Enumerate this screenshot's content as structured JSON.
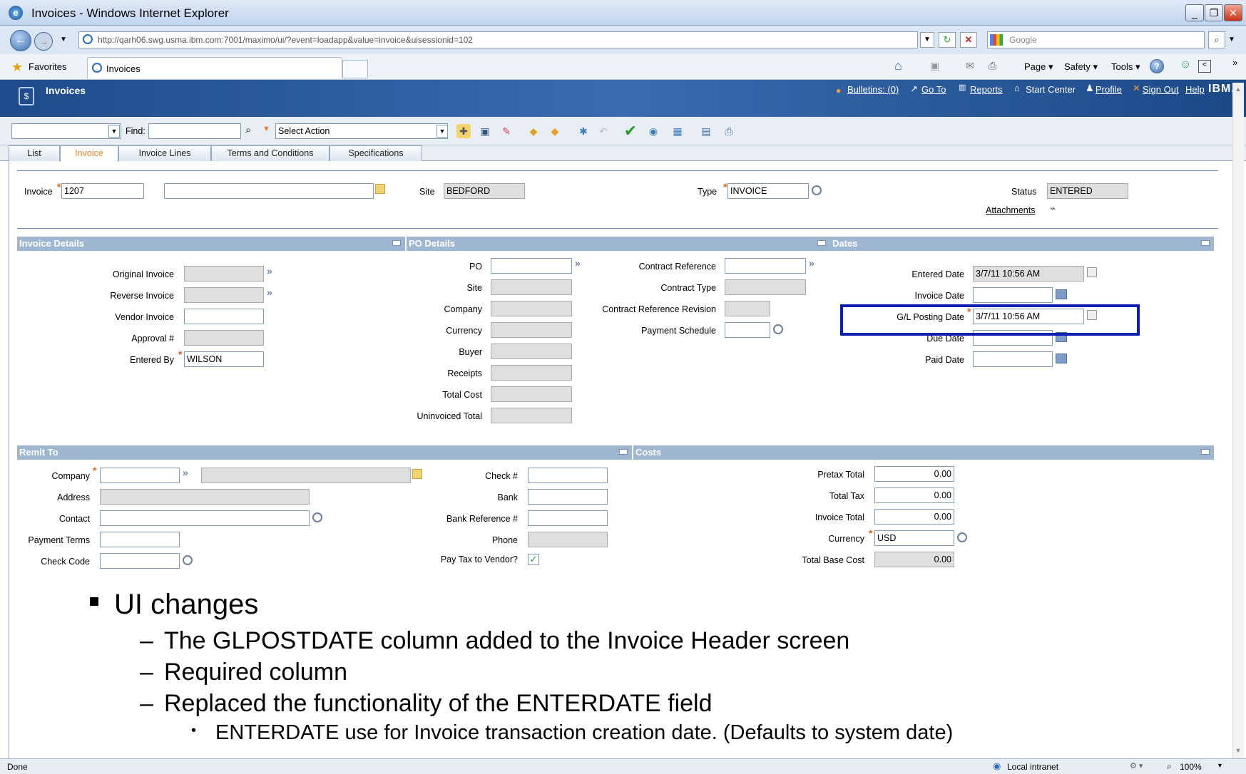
{
  "window": {
    "title": "Invoices - Windows Internet Explorer"
  },
  "browser": {
    "url": "http://qarh06.swg.usma.ibm.com:7001/maximo/ui/?event=loadapp&value=invoice&uisessionid=102",
    "search_placeholder": "Google",
    "favorites_label": "Favorites",
    "tab_label": "Invoices",
    "page_menu": "Page ▾",
    "safety_menu": "Safety ▾",
    "tools_menu": "Tools ▾"
  },
  "app": {
    "title": "Invoices",
    "links": {
      "bulletins": "Bulletins: (0)",
      "goto": "Go To",
      "reports": "Reports",
      "start_center": "Start Center",
      "profile": "Profile",
      "sign_out": "Sign Out",
      "help": "Help"
    },
    "brand": "IBM."
  },
  "toolbar": {
    "find_label": "Find:",
    "select_action": "Select Action"
  },
  "tabs": [
    "List",
    "Invoice",
    "Invoice Lines",
    "Terms and Conditions",
    "Specifications"
  ],
  "header": {
    "invoice_label": "Invoice",
    "invoice_value": "1207",
    "site_label": "Site",
    "site_value": "BEDFORD",
    "type_label": "Type",
    "type_value": "INVOICE",
    "status_label": "Status",
    "status_value": "ENTERED",
    "attachments_label": "Attachments"
  },
  "invoice_details": {
    "title": "Invoice Details",
    "fields": [
      {
        "label": "Original Invoice",
        "value": ""
      },
      {
        "label": "Reverse Invoice",
        "value": ""
      },
      {
        "label": "Vendor Invoice",
        "value": ""
      },
      {
        "label": "Approval #",
        "value": ""
      },
      {
        "label": "Entered By",
        "value": "WILSON"
      }
    ]
  },
  "po_details": {
    "title": "PO Details",
    "fields": [
      "PO",
      "Site",
      "Company",
      "Currency",
      "Buyer",
      "Receipts",
      "Total Cost",
      "Uninvoiced Total"
    ],
    "fields2": [
      "Contract Reference",
      "Contract Type",
      "Contract Reference Revision",
      "Payment Schedule"
    ]
  },
  "dates": {
    "title": "Dates",
    "fields": [
      {
        "label": "Entered Date",
        "value": "3/7/11 10:56 AM"
      },
      {
        "label": "Invoice Date",
        "value": ""
      },
      {
        "label": "G/L Posting Date",
        "value": "3/7/11 10:56 AM"
      },
      {
        "label": "Due Date",
        "value": ""
      },
      {
        "label": "Paid Date",
        "value": ""
      }
    ]
  },
  "remit_to": {
    "title": "Remit To",
    "fields": [
      "Company",
      "Address",
      "Contact",
      "Payment Terms",
      "Check Code"
    ],
    "fields2": [
      "Check #",
      "Bank",
      "Bank Reference #",
      "Phone",
      "Pay Tax to Vendor?"
    ]
  },
  "costs": {
    "title": "Costs",
    "fields": [
      {
        "label": "Pretax Total",
        "value": "0.00"
      },
      {
        "label": "Total Tax",
        "value": "0.00"
      },
      {
        "label": "Invoice Total",
        "value": "0.00"
      },
      {
        "label": "Currency",
        "value": "USD"
      },
      {
        "label": "Total Base Cost",
        "value": "0.00"
      }
    ]
  },
  "notes": {
    "heading": "UI changes",
    "items": [
      "The GLPOSTDATE column added to the Invoice Header screen",
      "Required column",
      "Replaced the functionality of the ENTERDATE field"
    ],
    "sub_item": "ENTERDATE use for Invoice transaction creation date. (Defaults to system date)"
  },
  "status": {
    "left": "Done",
    "zone": "Local intranet",
    "zoom": "100%"
  },
  "colors": {
    "highlight_box": "#0a1fb0",
    "required": "#e2621b",
    "section_header": "#9fb6d1"
  }
}
